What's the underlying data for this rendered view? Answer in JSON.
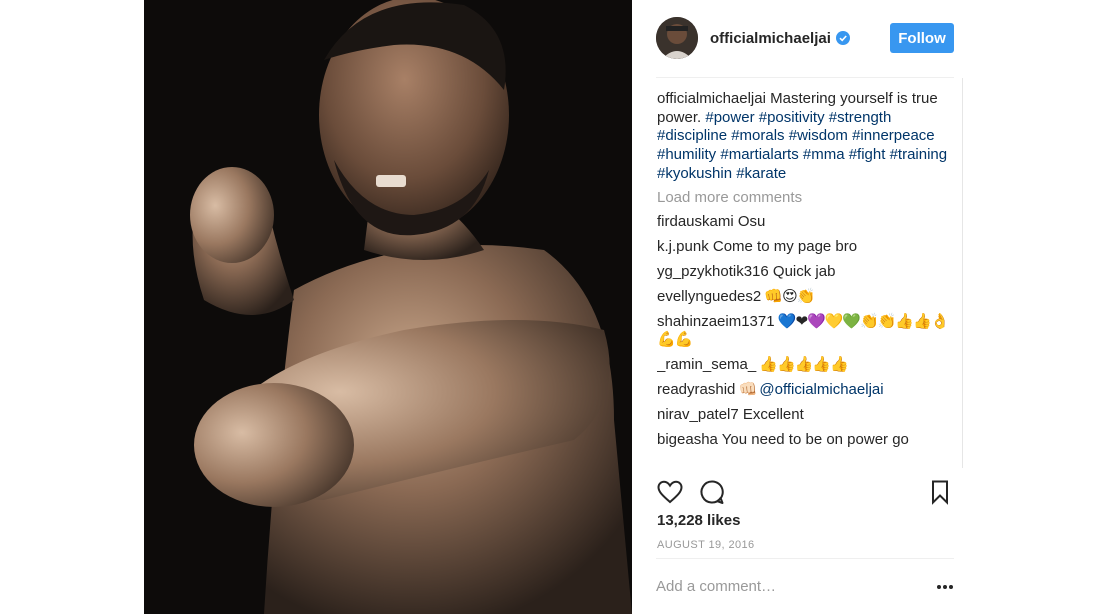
{
  "post": {
    "username": "officialmichaeljai",
    "follow_label": "Follow",
    "icons": {
      "verified": "verified-badge-icon",
      "like": "heart-icon",
      "comment": "comment-bubble-icon",
      "save": "bookmark-icon",
      "more": "more-options-icon"
    },
    "colors": {
      "accent": "#3897f0",
      "hashtag": "#003569",
      "muted": "#999999"
    }
  },
  "caption": {
    "username": "officialmichaeljai",
    "text": " Mastering yourself is true power. ",
    "hashtags": "#power #positivity #strength #discipline #morals #wisdom #innerpeace #humility #martialarts #mma #fight #training #kyokushin #karate"
  },
  "load_more_label": "Load more comments",
  "comments": [
    {
      "user": "firdauskami",
      "text": " Osu"
    },
    {
      "user": "k.j.punk",
      "text": " Come to my page bro"
    },
    {
      "user": "yg_pzykhotik316",
      "text": " Quick jab"
    },
    {
      "user": "evellynguedes2",
      "text": " 👊😍👏"
    },
    {
      "user": "shahinzaeim1371",
      "text": " 💙❤💜💛💚👏👏👍👍👌💪💪"
    },
    {
      "user": "_ramin_sema_",
      "text": " 👍👍👍👍👍"
    },
    {
      "user": "readyrashid",
      "text": " 👊🏻 ",
      "mention": "@officialmichaeljai"
    },
    {
      "user": "nirav_patel7",
      "text": " Excellent"
    },
    {
      "user": "bigeasha",
      "text": " You need to be on power go"
    }
  ],
  "likes": "13,228 likes",
  "date": "AUGUST 19, 2016",
  "add_comment_placeholder": "Add a comment…"
}
